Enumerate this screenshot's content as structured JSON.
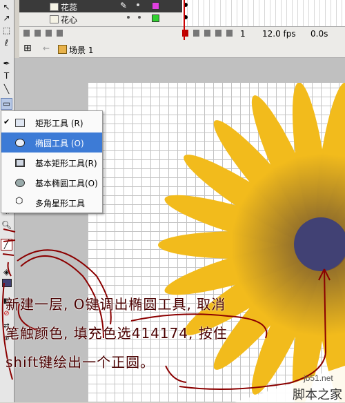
{
  "timeline": {
    "layers": [
      {
        "name": "花蕊",
        "color": "#e040e0",
        "selected": true
      },
      {
        "name": "花心",
        "color": "#30d030",
        "selected": false
      }
    ],
    "frame_number": "1",
    "fps": "12.0 fps",
    "time": "0.0s"
  },
  "editbar": {
    "scene": "场景 1"
  },
  "menu": {
    "items": [
      {
        "label": "矩形工具 (R)",
        "checked": "✔"
      },
      {
        "label": "椭圆工具 (O)"
      },
      {
        "label": "基本矩形工具(R)"
      },
      {
        "label": "基本椭圆工具(O)"
      },
      {
        "label": "多角星形工具"
      }
    ]
  },
  "tools": {
    "text_tool": "T"
  },
  "annotation": {
    "line1": "新建一层, O键调出椭圆工具, 取消",
    "line2": "笔触颜色, 填充色选414174, 按住",
    "line3": "shift键绘出一个正圆。"
  },
  "colors": {
    "petal_outer": "#f2bb1c",
    "petal_dark": "#7a5a2e",
    "center": "#414174",
    "annotation": "#4a0000"
  },
  "watermark": {
    "site": "jb51.net",
    "name": "脚本之家"
  }
}
